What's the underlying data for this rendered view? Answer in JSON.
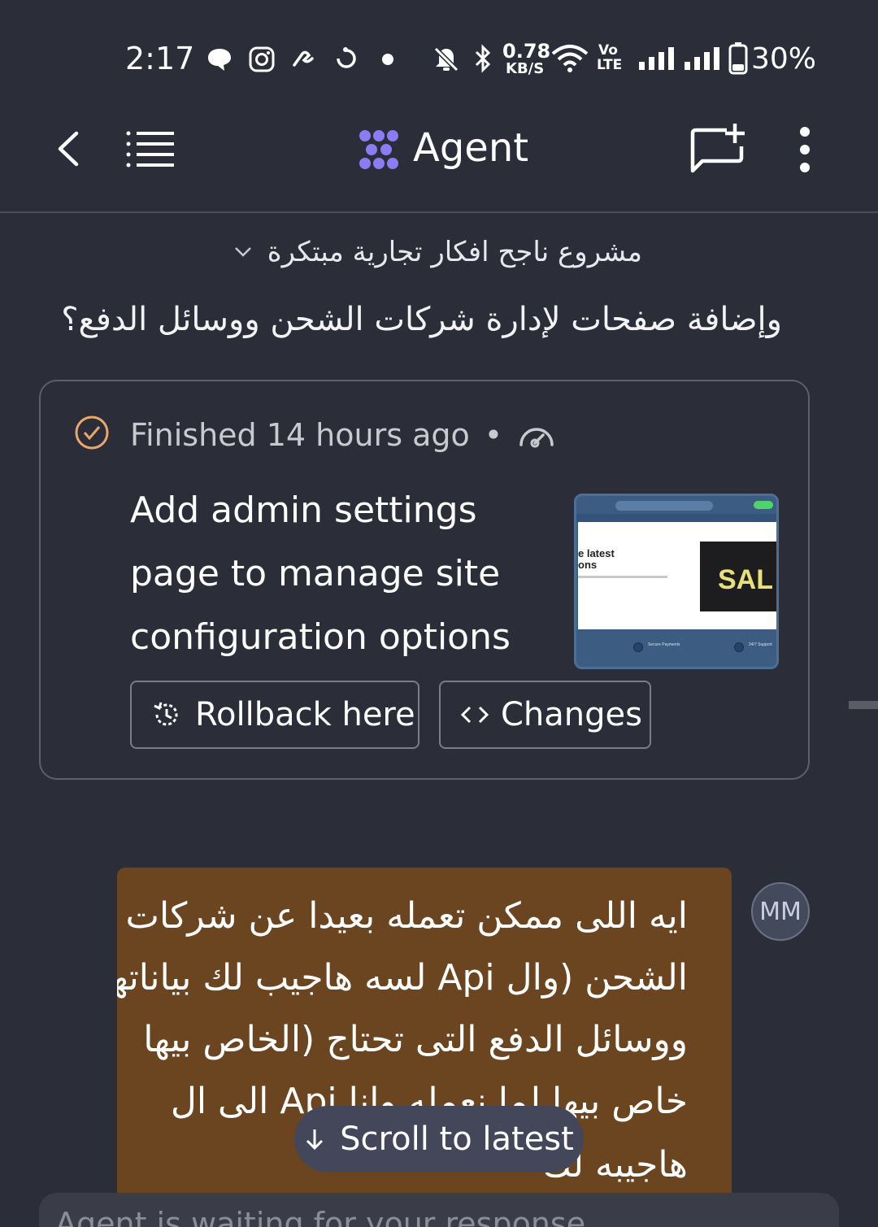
{
  "status_bar": {
    "time": "2:17",
    "net_speed_value": "0.78",
    "net_speed_unit": "KB/S",
    "volte_top": "Vo",
    "volte_bottom": "LTE",
    "battery": "30%"
  },
  "header": {
    "title": "Agent",
    "icons": [
      "back-icon",
      "menu-list-icon",
      "agent-logo-icon",
      "new-chat-icon",
      "more-options-icon"
    ]
  },
  "project": {
    "name": "مشروع ناجح افكار تجارية مبتكرة"
  },
  "question": "وإضافة صفحات لإدارة شركات الشحن ووسائل الدفع؟",
  "card": {
    "status": "Finished 14 hours ago",
    "separator": "•",
    "title": "Add admin settings page to manage site configuration options",
    "thumbnail": {
      "hero_line1": "e latest",
      "hero_line2": "ons",
      "sale": "SAL",
      "footer_left": "Secure Payments",
      "footer_right": "24/7 Support"
    },
    "rollback_label": "Rollback here",
    "changes_label": "Changes"
  },
  "message": {
    "avatar": "MM",
    "lines": [
      "ايه اللى ممكن تعمله بعيدا عن شركات",
      "الشحن (وال Api لسه هاجيب لك بياناتها",
      "ووسائل الدفع التى تحتاج (الخاص بيها",
      "خاص بيها لما نعمله وانا Api الى ال",
      "هاجيبه لك"
    ],
    "bubble_color": "#6b4520"
  },
  "scroll_to_latest": "Scroll to latest",
  "waiting": "Agent is waiting for your response",
  "colors": {
    "background": "#2b2d38",
    "accent_logo": "#8b7cf6",
    "check": "#e9a86b"
  }
}
